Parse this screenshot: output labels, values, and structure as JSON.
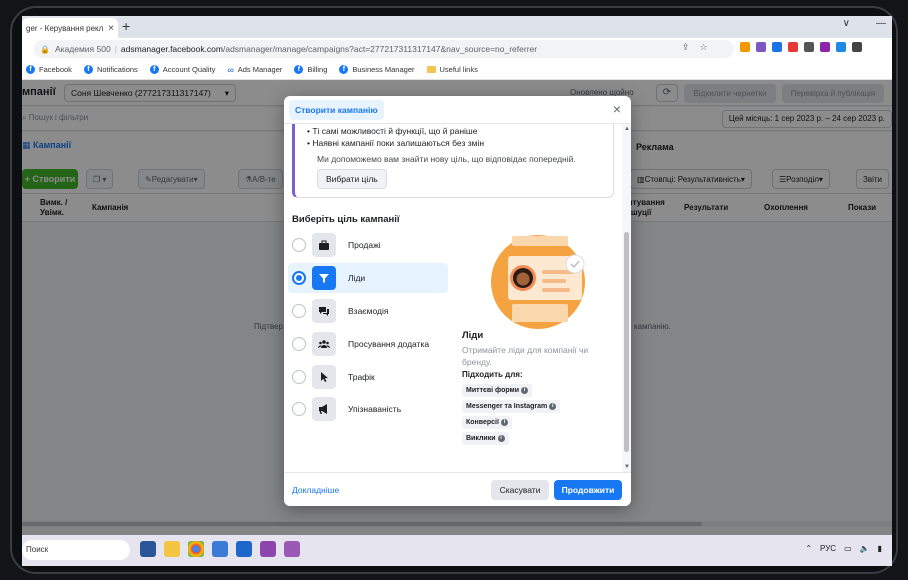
{
  "browser": {
    "tab_title": "ger - Керування рекл...",
    "tab_close": "×",
    "new_tab": "+",
    "win_min": "∨",
    "win_minimize": "—",
    "url_site_label": "Академия 500",
    "url_host": "adsmanager.facebook.com",
    "url_path": "/adsmanager/manage/campaigns?act=277217311317147&nav_source=no_referrer",
    "bookmarks": [
      "Facebook",
      "Notifications",
      "Account Quality",
      "Ads Manager",
      "Billing",
      "Business Manager",
      "Useful links"
    ]
  },
  "page": {
    "title": "мпанії",
    "account": "Соня Шевченко (277217311317147)",
    "saved_text": "Оновлено щойно",
    "discard_btn": "Відхилити чернетки",
    "review_btn": "Перевірка й публікація",
    "search_placeholder": "Пошук і фільтри",
    "date_range": "Цей місяць: 1 сер 2023 р. – 24 сер 2023 р.",
    "tab_campaigns": "Кампанії",
    "tab_ads": "Реклама",
    "create_btn": "+ Створити",
    "edit_btn": "Редагувати",
    "ab_btn": "А/В-те",
    "columns_btn": "Стовпці: Результативність",
    "breakdown_btn": "Розподіл",
    "reports_btn": "Звіти",
    "col_toggle": "Вимк. / Увімк.",
    "col_campaign": "Кампанія",
    "col_setup": "штування ршуції",
    "col_results": "Результати",
    "col_reach": "Охоплення",
    "col_impressions": "Покази",
    "empty_left": "Підтвер",
    "empty_right": "кампанію."
  },
  "taskbar": {
    "search": "Поиск",
    "lang": "РУС"
  },
  "modal": {
    "tab_title": "Створити кампанію",
    "close": "×",
    "bullet1": "Ті самі можливості й функції, що й раніше",
    "bullet2": "Наявні кампанії поки залишаються без змін",
    "help_text": "Ми допоможемо вам знайти нову ціль, що відповідає попередній.",
    "choose_btn": "Вибрати ціль",
    "section_title": "Виберіть ціль кампанії",
    "objectives": [
      {
        "label": "Продажі",
        "icon": "briefcase-icon",
        "selected": false
      },
      {
        "label": "Ліди",
        "icon": "funnel-icon",
        "selected": true
      },
      {
        "label": "Взаємодія",
        "icon": "chat-icon",
        "selected": false
      },
      {
        "label": "Просування додатка",
        "icon": "people-icon",
        "selected": false
      },
      {
        "label": "Трафік",
        "icon": "cursor-icon",
        "selected": false
      },
      {
        "label": "Упізнаваність",
        "icon": "megaphone-icon",
        "selected": false
      }
    ],
    "detail_title": "Ліди",
    "detail_desc": "Отримайте ліди для компанії чи бренду.",
    "detail_sub": "Підходить для:",
    "chips": [
      "Миттєві форми",
      "Messenger та Instagram",
      "Конверсії",
      "Виклики"
    ],
    "learn_more": "Докладніше",
    "cancel_btn": "Скасувати",
    "continue_btn": "Продовжити"
  },
  "colors": {
    "accent": "#1877f2",
    "create_green": "#42b72a",
    "illustration_orange": "#f4a340"
  }
}
